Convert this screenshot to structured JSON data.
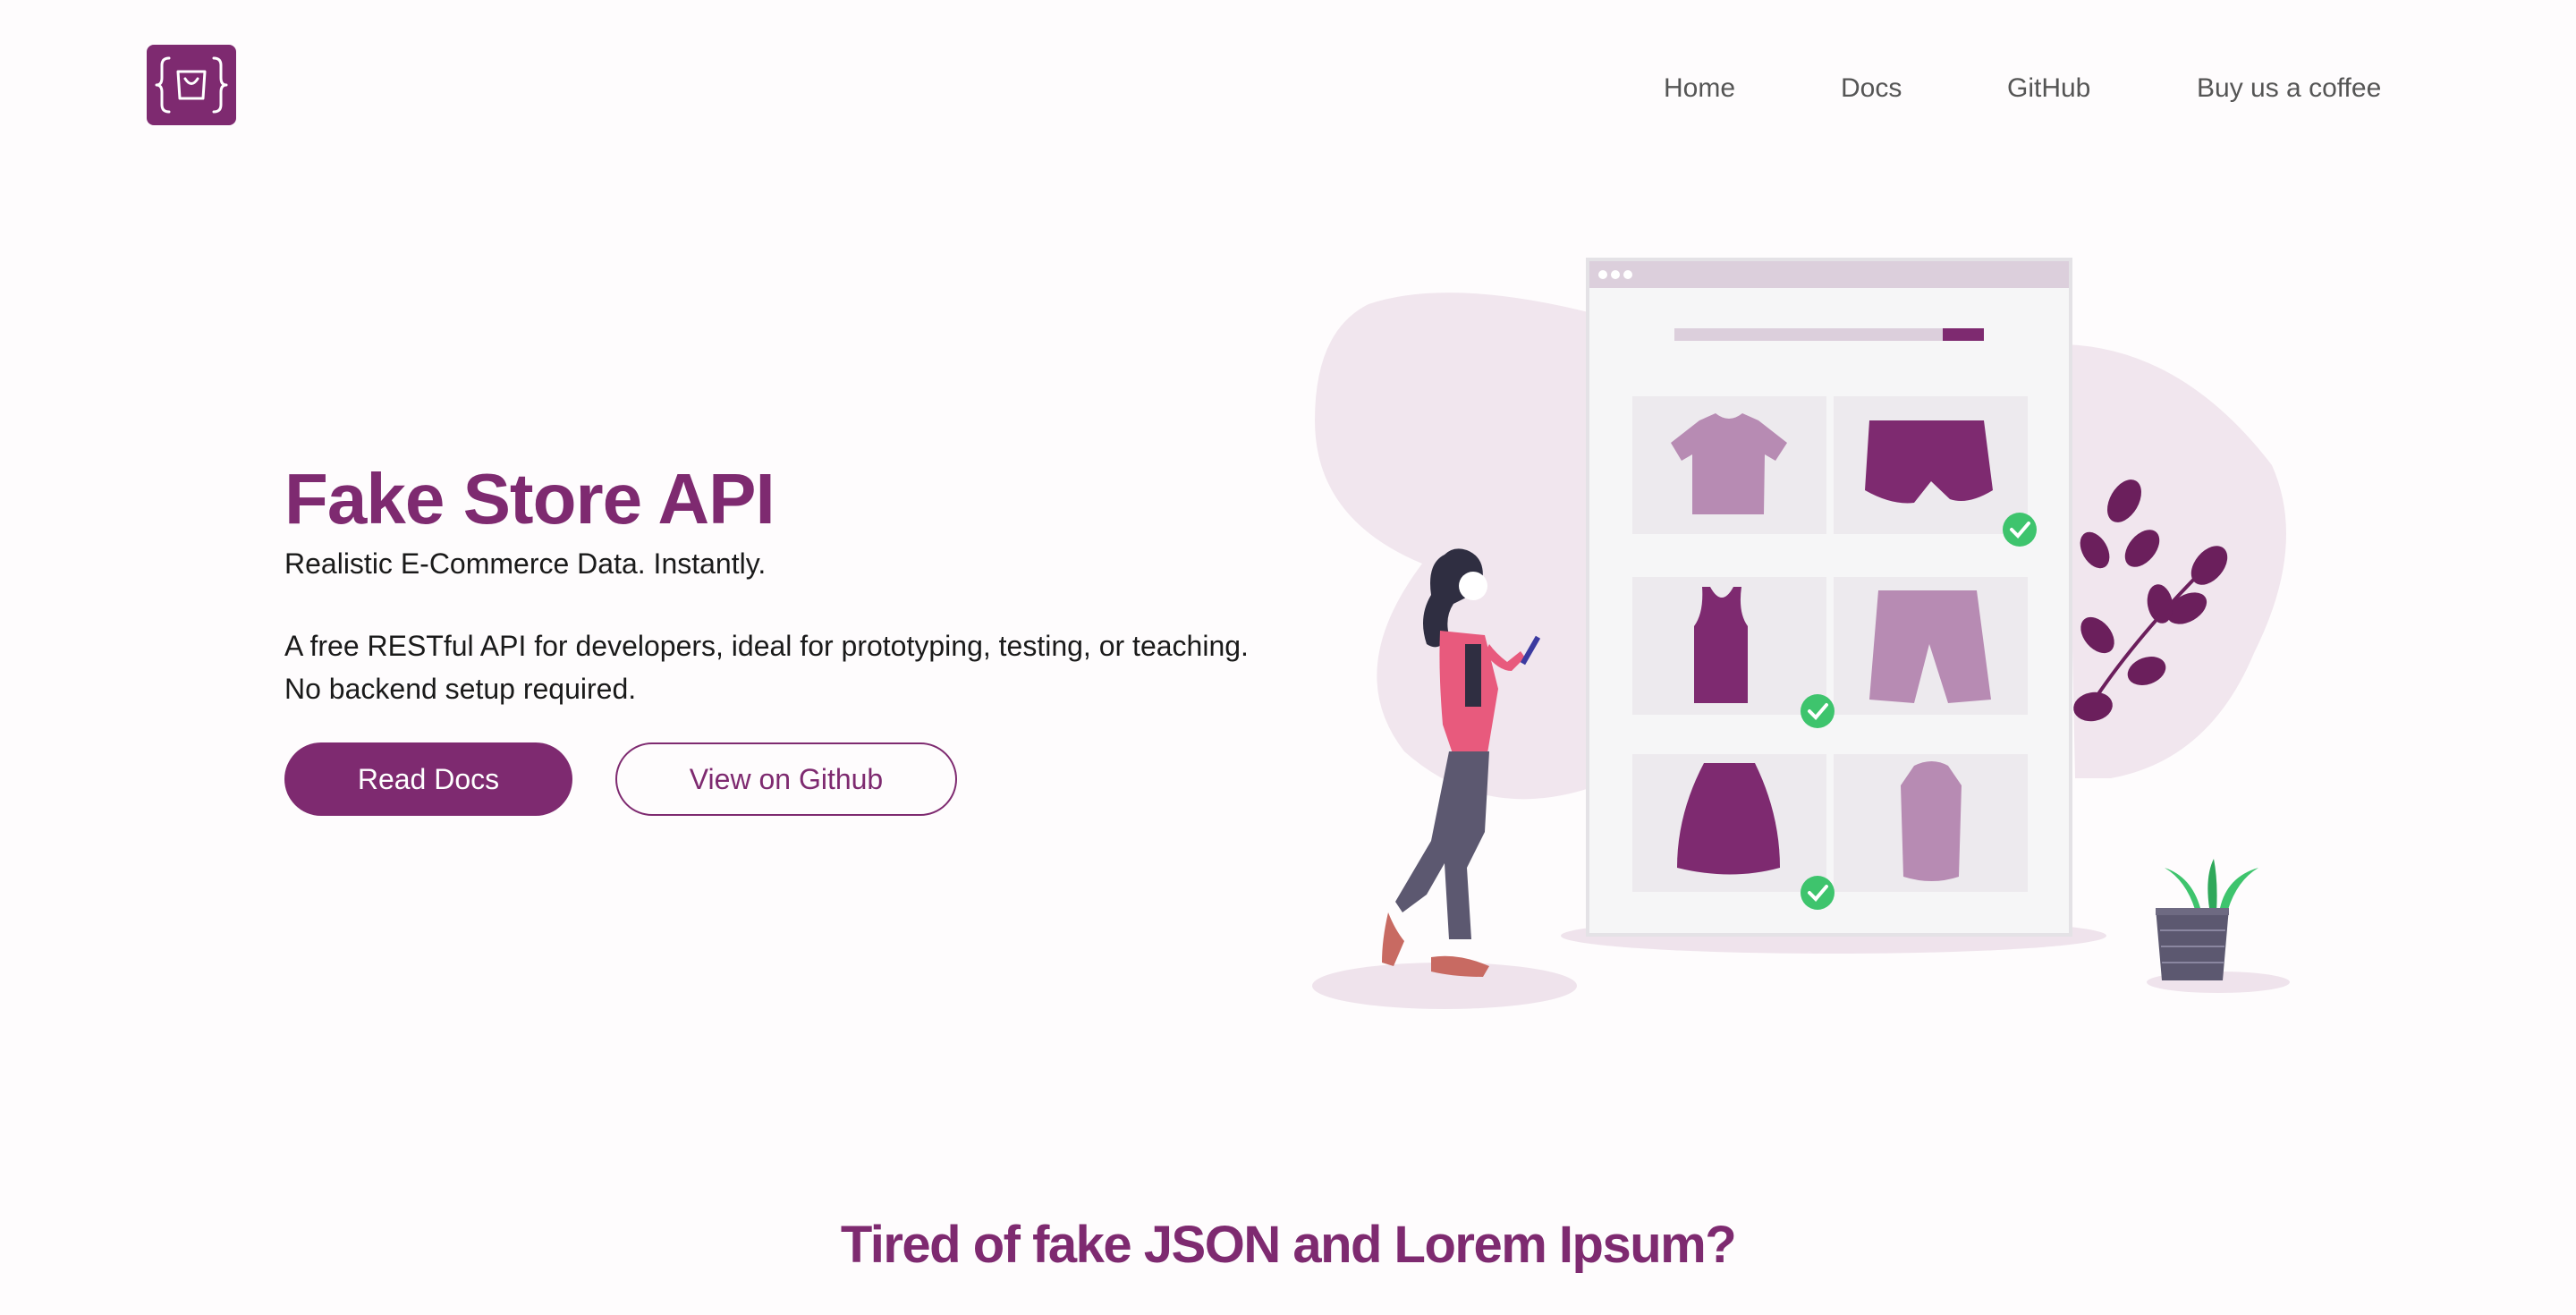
{
  "header": {
    "logo_icon": "shopping-bag-braces-icon",
    "nav": [
      {
        "label": "Home"
      },
      {
        "label": "Docs"
      },
      {
        "label": "GitHub"
      },
      {
        "label": "Buy us a coffee"
      }
    ]
  },
  "hero": {
    "title": "Fake Store API",
    "tagline": "Realistic E-Commerce Data. Instantly.",
    "description_line1": "A free RESTful API for developers, ideal for prototyping, testing, or teaching.",
    "description_line2": "No backend setup required.",
    "primary_button": "Read Docs",
    "secondary_button": "View on Github"
  },
  "section": {
    "title": "Tired of fake JSON and Lorem Ipsum?"
  },
  "colors": {
    "brand": "#7e2a70",
    "background": "#fefcfd",
    "check": "#3ec46d"
  }
}
